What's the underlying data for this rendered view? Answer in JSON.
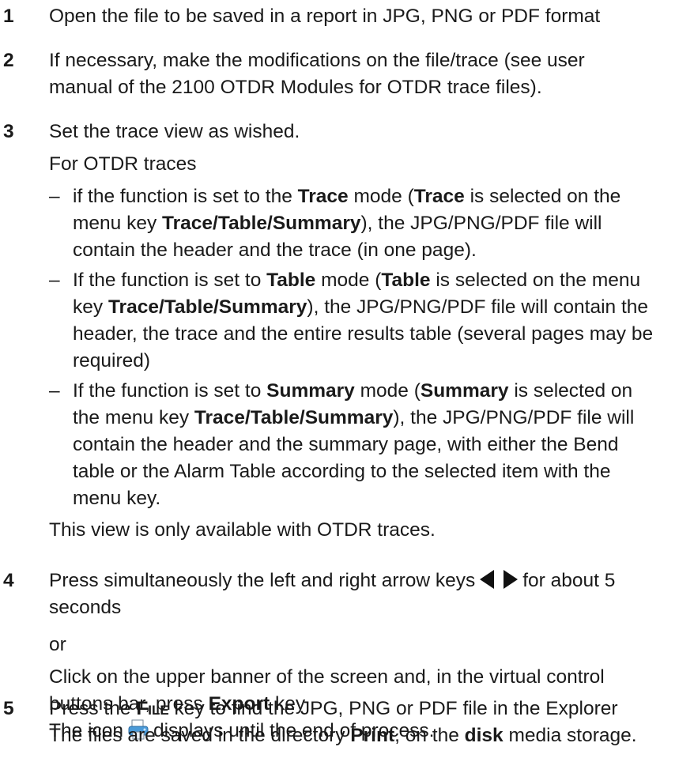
{
  "steps": [
    {
      "number": "1",
      "text": "Open the file to be saved in a report in JPG, PNG or PDF format"
    },
    {
      "number": "2",
      "line1": "If necessary, make the modifications on the file/trace (see user",
      "line2": "manual of the 2100 OTDR Modules for OTDR trace files)."
    },
    {
      "number": "3",
      "text": "Set the trace view as wished.",
      "subhead": "For OTDR traces",
      "bullets": [
        {
          "l1a": "if the function is set to the ",
          "l1b": "Trace",
          "l1c": " mode (",
          "l1d": "Trace",
          "l1e": " is selected on the",
          "l2a": "menu key ",
          "l2b": "Trace/Table/Summary",
          "l2c": "), the JPG/PNG/PDF file will",
          "l3": "contain the header and the trace (in one page)."
        },
        {
          "l1a": "If the function is set to ",
          "l1b": "Table",
          "l1c": " mode (",
          "l1d": "Table",
          "l1e": " is selected on the menu",
          "l2a": "key ",
          "l2b": "Trace/Table/Summary",
          "l2c": "), the JPG/PNG/PDF file will contain the",
          "l3": "header, the trace and the entire results table (several pages may be",
          "l4": "required)"
        },
        {
          "l1a": "If the function is set to ",
          "l1b": "Summary",
          "l1c": " mode (",
          "l1d": "Summary",
          "l1e": " is selected on",
          "l2a": "the menu key ",
          "l2b": "Trace/Table/Summary",
          "l2c": "), the JPG/PNG/PDF file will",
          "l3": "contain the header and the summary page, with either the Bend",
          "l4": "table or the Alarm Table according to the selected item with the",
          "l5": "menu key."
        }
      ],
      "note": "This view is only available with OTDR traces."
    },
    {
      "number": "4",
      "line1a": "Press simultaneously the left and right arrow keys",
      "line1b": "for about 5",
      "line2": "seconds",
      "or": "or",
      "line3": "Click on the upper banner of the screen and, in the virtual control",
      "line4a": "buttons bar, press ",
      "line4b": "Export",
      "line4c": " key",
      "line5a": "The icon",
      "line5b": "displays until the end of process."
    },
    {
      "number": "5",
      "line1a": "Press the ",
      "line1b": "File",
      "line1c": " key to find the JPG, PNG or PDF file in the Explorer",
      "line2a": "The files are saved in the directory ",
      "line2b": "Print",
      "line2c": ", on the ",
      "line2d": "disk",
      "line2e": " media storage."
    }
  ]
}
